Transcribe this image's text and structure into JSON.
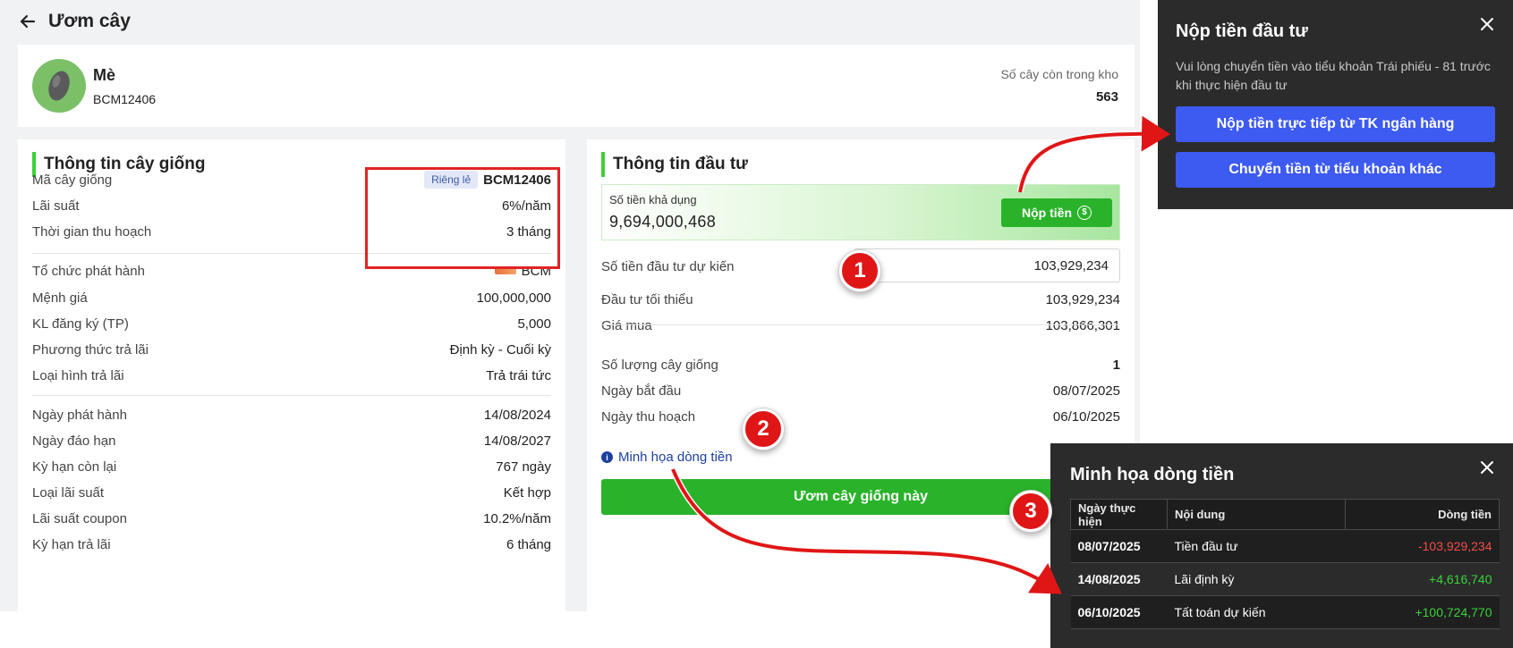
{
  "header": {
    "title": "Ươm cây"
  },
  "product": {
    "name": "Mè",
    "code": "BCM12406",
    "stock_label": "Số cây còn trong kho",
    "stock_value": "563"
  },
  "seedling_info": {
    "title": "Thông tin cây giống",
    "rows_group1": [
      {
        "label": "Mã cây giống",
        "badge": "Riêng lẻ",
        "value": "BCM12406"
      },
      {
        "label": "Lãi suất",
        "value": "6%/năm"
      },
      {
        "label": "Thời gian thu hoạch",
        "value": "3 tháng"
      }
    ],
    "rows_group2": [
      {
        "label": "Tổ chức phát hành",
        "value": "BCM"
      },
      {
        "label": "Mệnh giá",
        "value": "100,000,000"
      },
      {
        "label": "KL đăng ký (TP)",
        "value": "5,000"
      },
      {
        "label": "Phương thức trả lãi",
        "value": "Định kỳ - Cuối kỳ"
      },
      {
        "label": "Loại hình trả lãi",
        "value": "Trả trái tức"
      }
    ],
    "rows_group3": [
      {
        "label": "Ngày phát hành",
        "value": "14/08/2024"
      },
      {
        "label": "Ngày đáo hạn",
        "value": "14/08/2027"
      },
      {
        "label": "Kỳ hạn còn lại",
        "value": "767 ngày"
      },
      {
        "label": "Loại lãi suất",
        "value": "Kết hợp"
      },
      {
        "label": "Lãi suất coupon",
        "value": "10.2%/năm"
      },
      {
        "label": "Kỳ hạn trả lãi",
        "value": "6 tháng"
      }
    ]
  },
  "investment_info": {
    "title": "Thông tin đầu tư",
    "available_label": "Số tiền khả dụng",
    "available_value": "9,694,000,468",
    "deposit_label": "Nộp tiền",
    "expected_label": "Số tiền đầu tư dự kiến",
    "expected_value": "103,929,234",
    "min_label": "Đầu tư tối thiểu",
    "min_value": "103,929,234",
    "price_label": "Giá mua",
    "price_value": "103,866,301",
    "qty_label": "Số lượng cây giống",
    "qty_value": "1",
    "start_label": "Ngày bắt đầu",
    "start_value": "08/07/2025",
    "harvest_label": "Ngày thu hoạch",
    "harvest_value": "06/10/2025",
    "cashflow_link": "Minh họa dòng tiền",
    "plant_button": "Ươm cây giống này"
  },
  "deposit_modal": {
    "title": "Nộp tiền đầu tư",
    "description": "Vui lòng chuyển tiền vào tiểu khoản Trái phiếu - 81 trước khi thực hiện đầu tư",
    "bank_button": "Nộp tiền trực tiếp từ TK ngân hàng",
    "transfer_button": "Chuyển tiền từ tiểu khoản khác"
  },
  "cashflow_modal": {
    "title": "Minh họa dòng tiền",
    "headers": [
      "Ngày thực hiện",
      "Nội dung",
      "Dòng tiền"
    ],
    "rows": [
      {
        "date": "08/07/2025",
        "content": "Tiền đầu tư",
        "amount": "-103,929,234"
      },
      {
        "date": "14/08/2025",
        "content": "Lãi định kỳ",
        "amount": "+4,616,740"
      },
      {
        "date": "06/10/2025",
        "content": "Tất toán dự kiến",
        "amount": "+100,724,770"
      }
    ]
  },
  "markers": [
    "1",
    "2",
    "3"
  ],
  "colors": {
    "accent_green": "#2ab32a",
    "accent_blue": "#3d5af1",
    "highlight_red": "#e02424",
    "negative": "#f04d4d",
    "positive": "#3ad23a"
  }
}
